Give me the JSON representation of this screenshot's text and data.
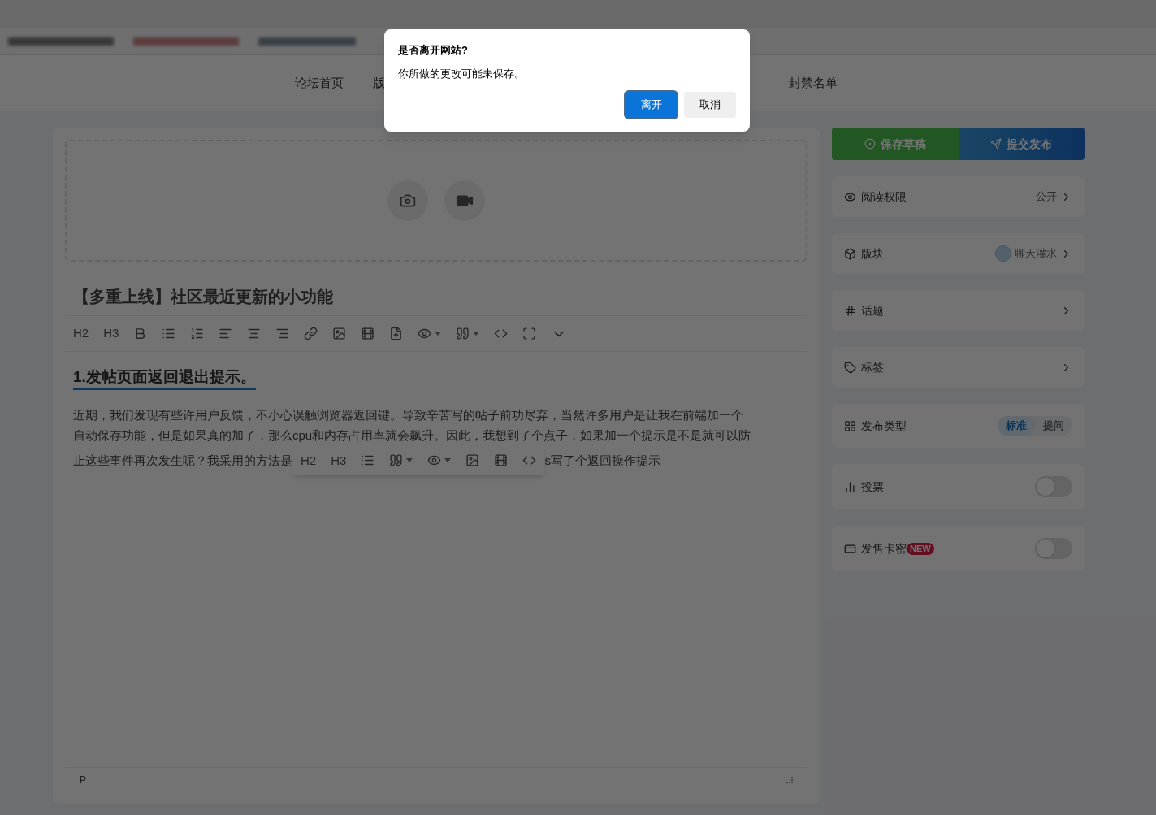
{
  "nav": {
    "items": [
      {
        "label": "论坛首页"
      },
      {
        "label": "版"
      },
      {
        "label": "封禁名单"
      }
    ]
  },
  "editor": {
    "title": "【多重上线】社区最近更新的小功能",
    "toolbar": {
      "headings": [
        "H2",
        "H3"
      ]
    },
    "heading": "1.发帖页面返回退出提示。",
    "paragraph_lines": [
      "近期，我们发现有些许用户反馈，不小心误触浏览器返回键。导致辛苦写的帖子前功尽弃，当然许多用户是让我在前端加一个",
      "自动保存功能，但是如果真的加了，那么cpu和内存占用率就会飙升。因此，我想到了个点子，如果加一个提示是不是就可以防"
    ],
    "last_line": {
      "before": "止这些事件再次发生呢？我采用的方法是",
      "after": "s写了个返回操作提示"
    },
    "floating_toolbar": {
      "headings": [
        "H2",
        "H3"
      ]
    },
    "status": "P"
  },
  "sidebar": {
    "save_button": "保存草稿",
    "publish_button": "提交发布",
    "settings": [
      {
        "kind": "link",
        "label": "阅读权限",
        "value": "公开"
      },
      {
        "kind": "section",
        "label": "版块",
        "value": "聊天灌水"
      },
      {
        "kind": "link",
        "label": "话题"
      },
      {
        "kind": "link",
        "label": "标签"
      },
      {
        "kind": "segmented",
        "label": "发布类型",
        "options": [
          {
            "label": "标准",
            "selected": true
          },
          {
            "label": "提问",
            "selected": false
          }
        ]
      },
      {
        "kind": "toggle",
        "label": "投票",
        "on": false
      },
      {
        "kind": "toggle",
        "label": "发售卡密",
        "badge": "NEW",
        "on": false
      }
    ]
  },
  "dialog": {
    "title": "是否离开网站?",
    "message": "你所做的更改可能未保存。",
    "buttons": [
      {
        "label": "离开",
        "kind": "primary"
      },
      {
        "label": "取消",
        "kind": "secondary"
      }
    ]
  }
}
